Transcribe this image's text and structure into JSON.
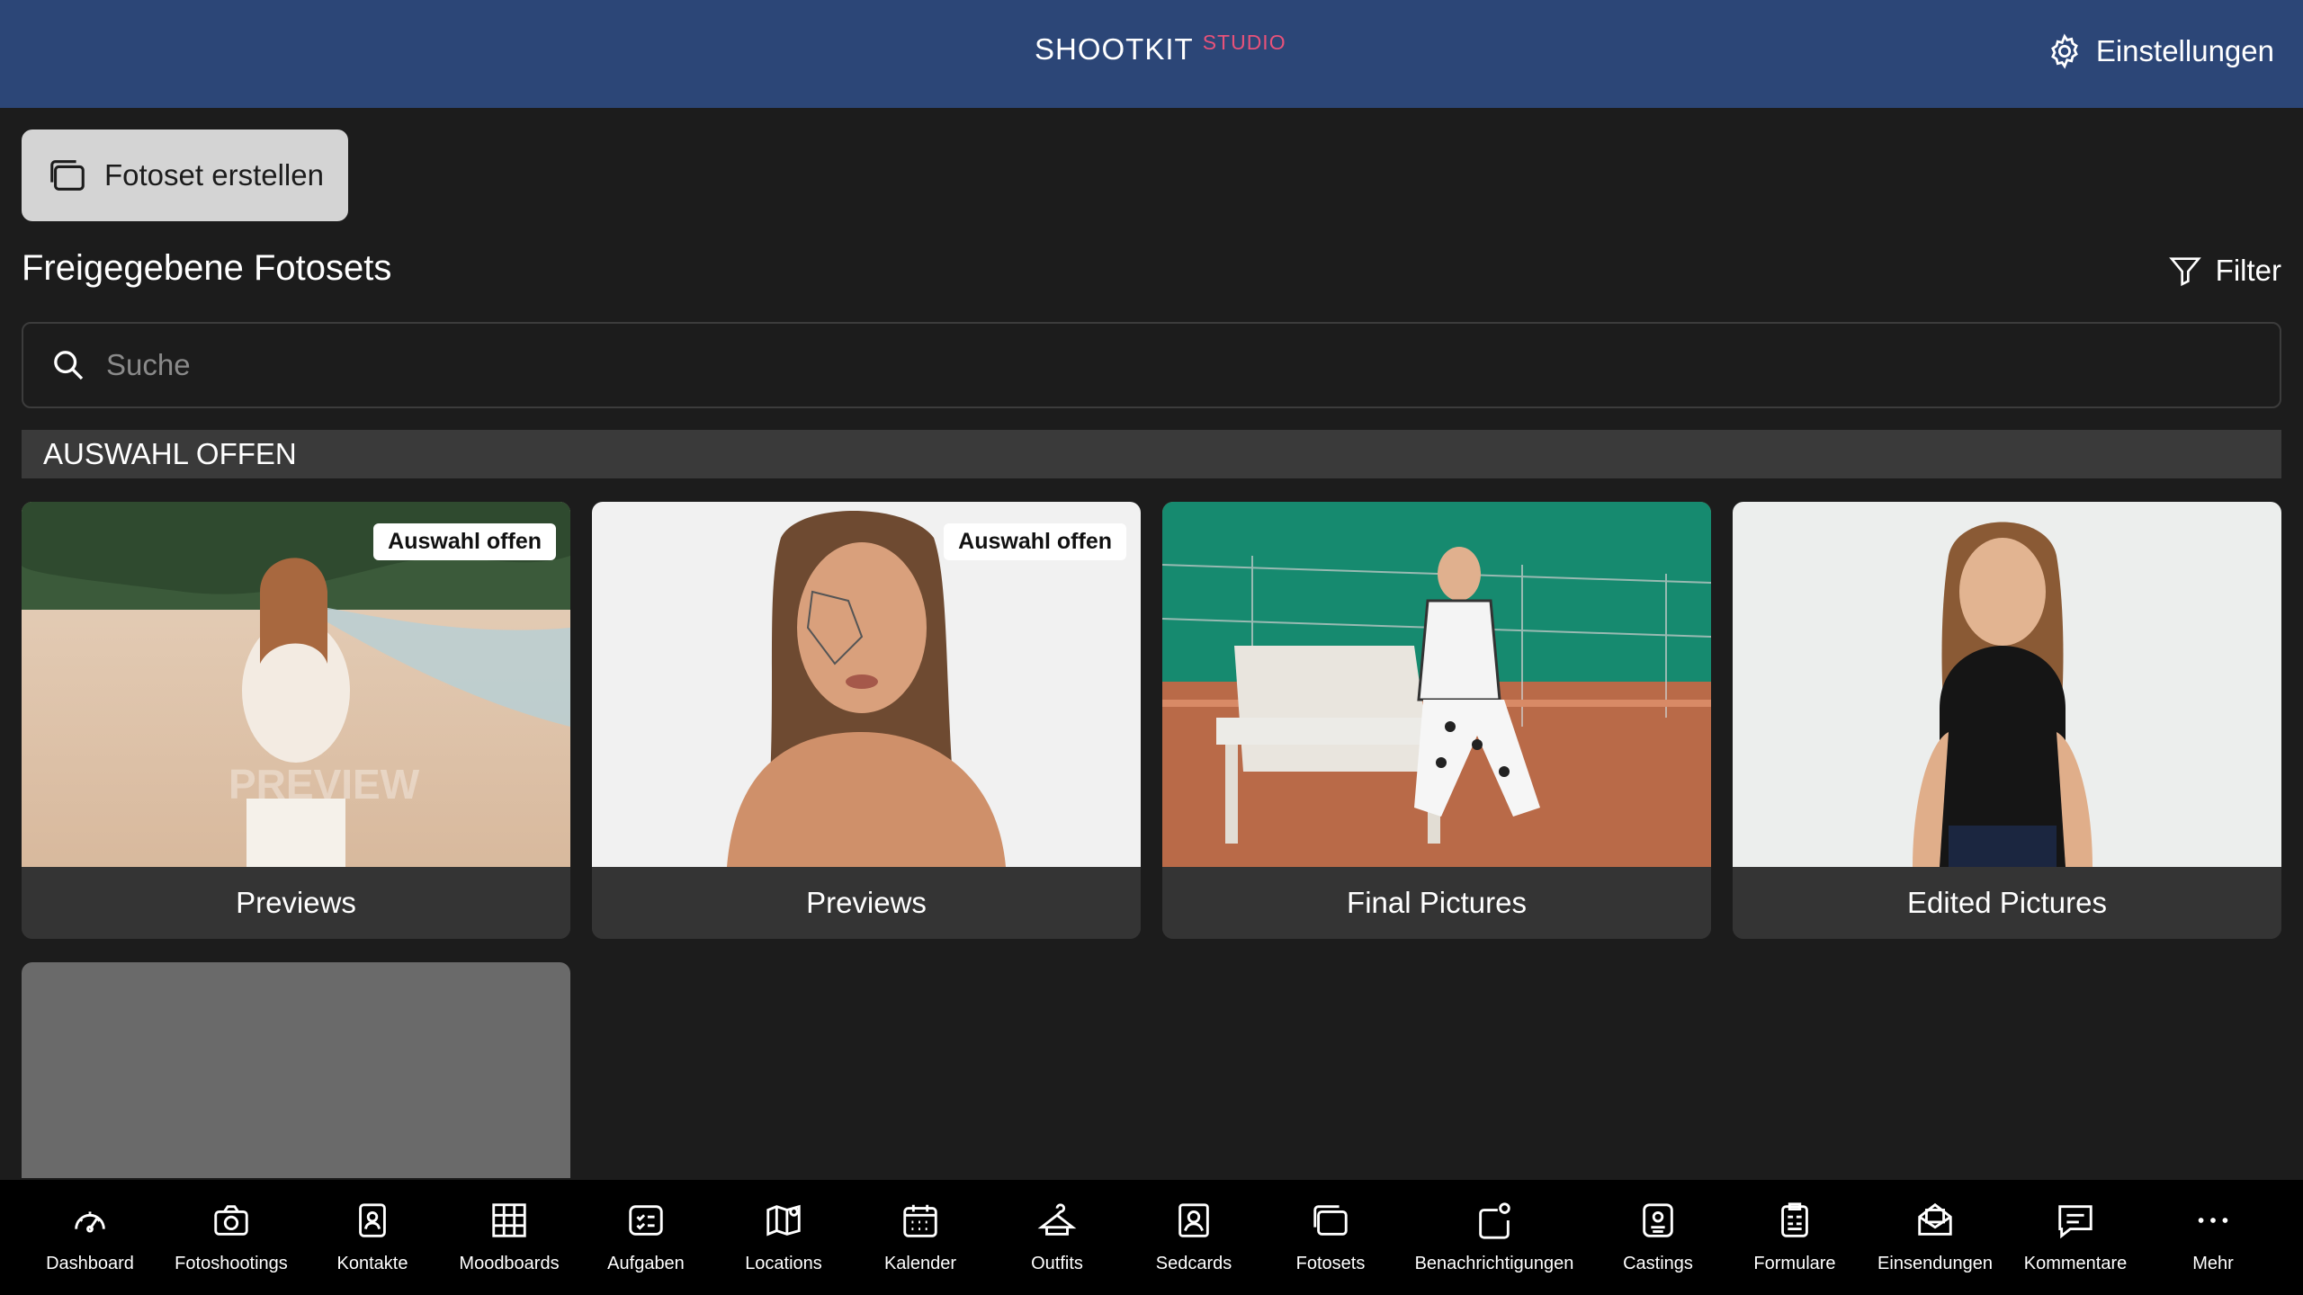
{
  "header": {
    "brand": "SHOOTKIT",
    "brand_sup": "STUDIO",
    "settings_label": "Einstellungen"
  },
  "toolbar": {
    "create_label": "Fotoset erstellen"
  },
  "section": {
    "title": "Freigegebene Fotosets",
    "filter_label": "Filter"
  },
  "search": {
    "placeholder": "Suche",
    "value": ""
  },
  "group": {
    "title": "AUSWAHL OFFEN"
  },
  "cards": [
    {
      "label": "Previews",
      "badge": "Auswahl offen",
      "watermark": "PREVIEW"
    },
    {
      "label": "Previews",
      "badge": "Auswahl offen"
    },
    {
      "label": "Final Pictures"
    },
    {
      "label": "Edited Pictures"
    }
  ],
  "nav": [
    {
      "label": "Dashboard",
      "icon": "gauge-icon"
    },
    {
      "label": "Fotoshootings",
      "icon": "camera-icon"
    },
    {
      "label": "Kontakte",
      "icon": "contact-icon"
    },
    {
      "label": "Moodboards",
      "icon": "grid-icon"
    },
    {
      "label": "Aufgaben",
      "icon": "checklist-icon"
    },
    {
      "label": "Locations",
      "icon": "map-icon"
    },
    {
      "label": "Kalender",
      "icon": "calendar-icon"
    },
    {
      "label": "Outfits",
      "icon": "shirt-icon"
    },
    {
      "label": "Sedcards",
      "icon": "portrait-card-icon"
    },
    {
      "label": "Fotosets",
      "icon": "photoset-icon"
    },
    {
      "label": "Benachrichtigungen",
      "icon": "bell-icon"
    },
    {
      "label": "Castings",
      "icon": "casting-icon"
    },
    {
      "label": "Formulare",
      "icon": "clipboard-icon"
    },
    {
      "label": "Einsendungen",
      "icon": "envelope-icon"
    },
    {
      "label": "Kommentare",
      "icon": "comment-icon"
    },
    {
      "label": "Mehr",
      "icon": "more-icon"
    }
  ]
}
